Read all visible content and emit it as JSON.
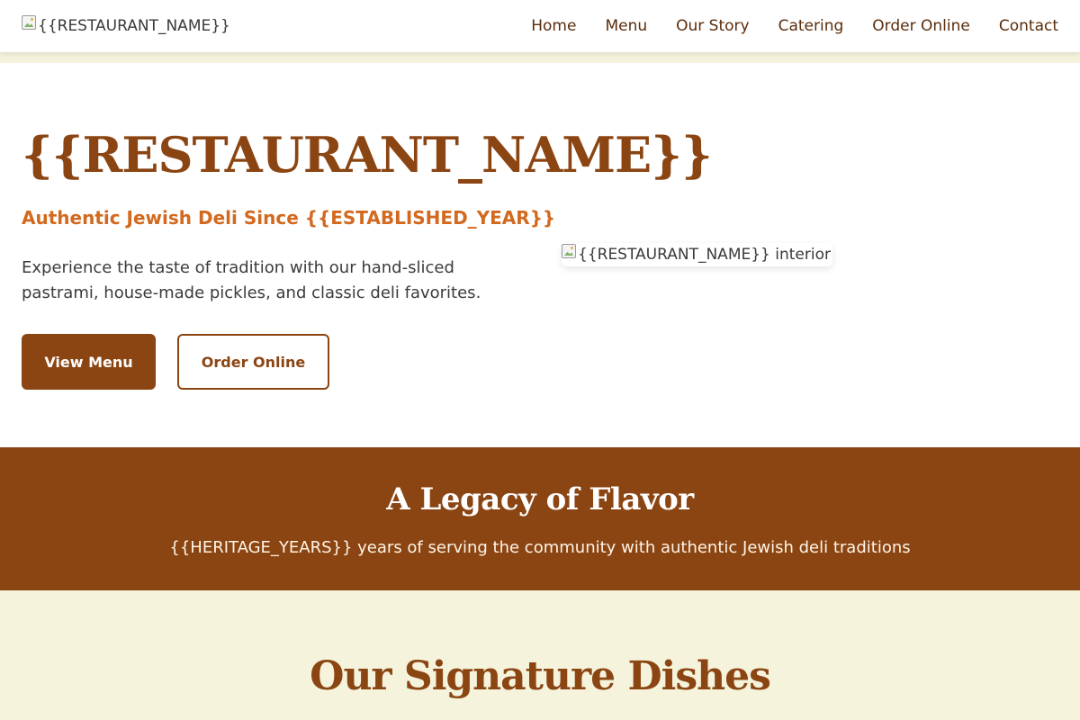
{
  "header": {
    "logo_alt": "{{RESTAURANT_NAME}}",
    "nav": [
      {
        "label": "Home"
      },
      {
        "label": "Menu"
      },
      {
        "label": "Our Story"
      },
      {
        "label": "Catering"
      },
      {
        "label": "Order Online"
      },
      {
        "label": "Contact"
      }
    ]
  },
  "hero": {
    "title": "{{RESTAURANT_NAME}}",
    "tagline": "Authentic Jewish Deli Since {{ESTABLISHED_YEAR}}",
    "description": "Experience the taste of tradition with our hand-sliced pastrami, house-made pickles, and classic deli favorites.",
    "primary_button": "View Menu",
    "secondary_button": "Order Online",
    "image_alt": "{{RESTAURANT_NAME}} interior"
  },
  "legacy": {
    "title": "A Legacy of Flavor",
    "text": "{{HERITAGE_YEARS}} years of serving the community with authentic Jewish deli traditions"
  },
  "signature": {
    "title": "Our Signature Dishes"
  },
  "colors": {
    "brand_brown": "#8b4513",
    "accent_orange": "#d2691e",
    "cream": "#f5f3dc"
  }
}
